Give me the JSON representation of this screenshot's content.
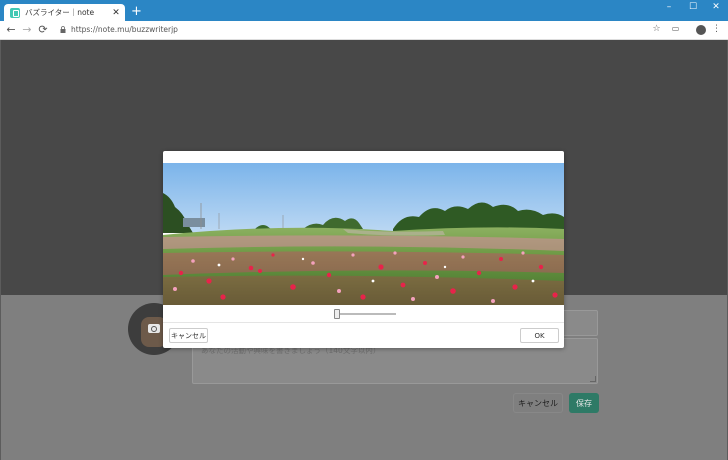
{
  "browser": {
    "tab_title": "バズライター｜note",
    "tab_close": "✕",
    "new_tab": "+",
    "url": "https://note.mu/buzzwriterjp",
    "window_minimize": "–",
    "window_maximize": "☐",
    "window_close": "✕",
    "back": "←",
    "forward": "→",
    "reload": "⟳",
    "star": "☆",
    "menu": "⋮",
    "cast": "▭",
    "tab_color": "#2b86c5"
  },
  "profile": {
    "bio_placeholder": "あなたの活動や興味を書きましょう（140文字以内）",
    "cancel_label": "キャンセル",
    "save_label": "保存",
    "save_color": "#2e7a66"
  },
  "crop_modal": {
    "photo_icon": "flower-field-photo",
    "zoom": 0.0,
    "cancel_label": "キャンセル",
    "ok_label": "OK"
  }
}
